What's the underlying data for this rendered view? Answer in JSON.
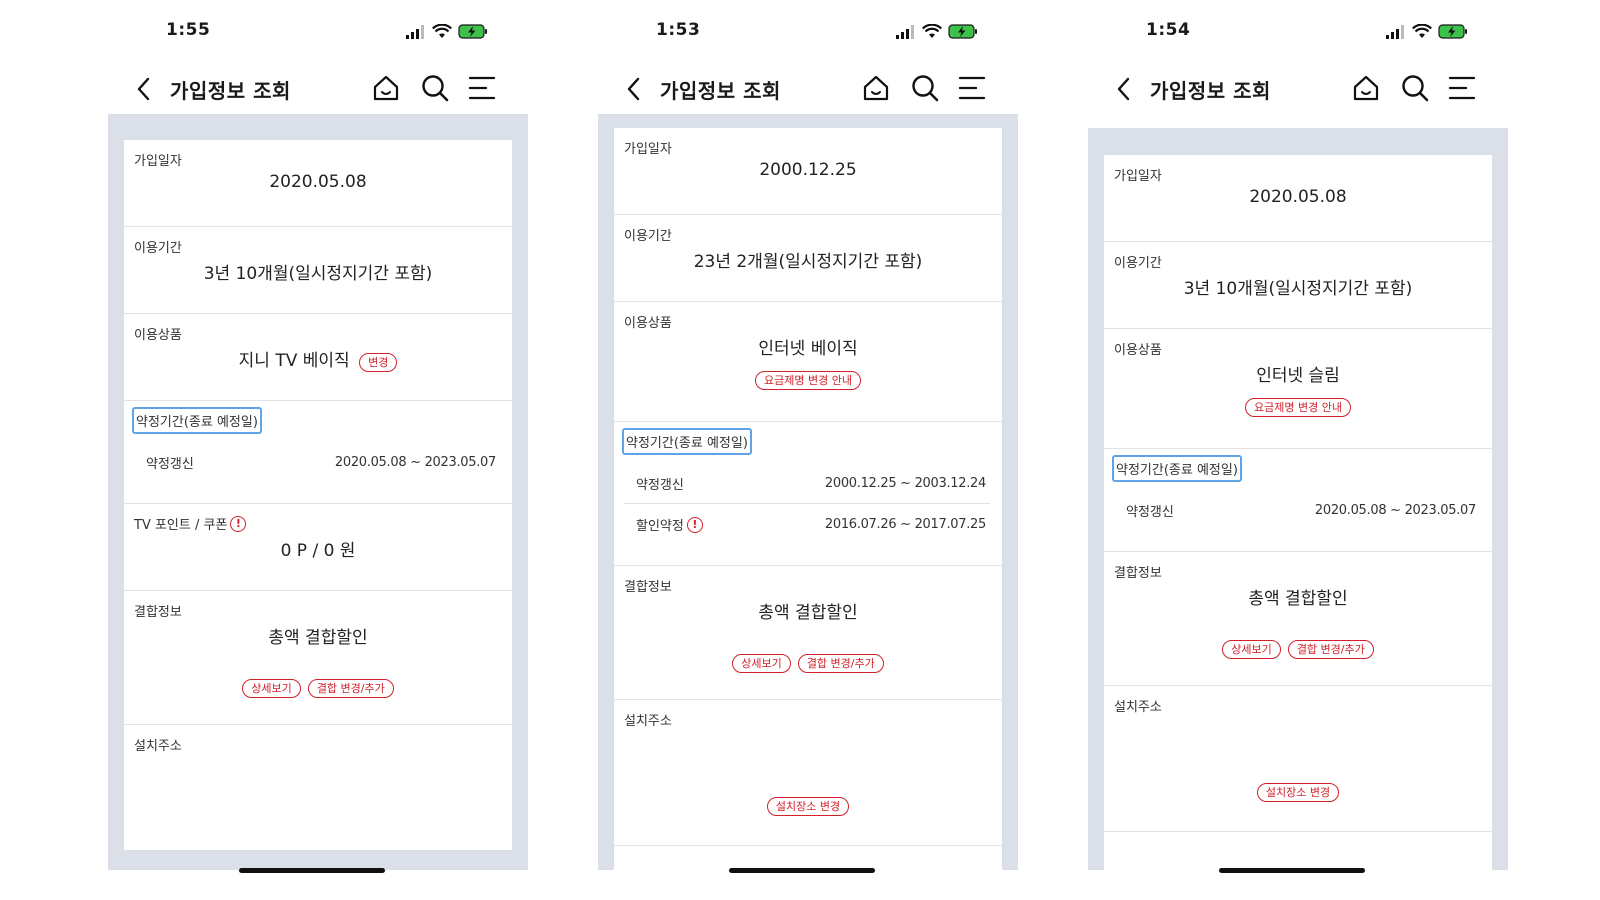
{
  "screens": [
    {
      "time": "1:55",
      "title": "가입정보 조회",
      "join_date": {
        "label": "가입일자",
        "value": "2020.05.08"
      },
      "period": {
        "label": "이용기간",
        "value": "3년 10개월(일시정지기간 포함)"
      },
      "product": {
        "label": "이용상품",
        "value": "지니 TV 베이직",
        "button": "변경"
      },
      "contract": {
        "label": "약정기간(종료 예정일)",
        "rows": [
          {
            "label": "약정갱신",
            "value": "2020.05.08 ~ 2023.05.07"
          }
        ]
      },
      "points": {
        "label": "TV 포인트 / 쿠폰",
        "value": "0 P / 0 원"
      },
      "bundle": {
        "label": "결합정보",
        "value": "총액 결합할인",
        "buttons": [
          "상세보기",
          "결합 변경/추가"
        ]
      },
      "address": {
        "label": "설치주소"
      }
    },
    {
      "time": "1:53",
      "title": "가입정보 조회",
      "join_date": {
        "label": "가입일자",
        "value": "2000.12.25"
      },
      "period": {
        "label": "이용기간",
        "value": "23년 2개월(일시정지기간 포함)"
      },
      "product": {
        "label": "이용상품",
        "value": "인터넷 베이직",
        "button": "요금제명 변경 안내"
      },
      "contract": {
        "label": "약정기간(종료 예정일)",
        "rows": [
          {
            "label": "약정갱신",
            "value": "2000.12.25 ~ 2003.12.24"
          },
          {
            "label": "할인약정",
            "value": "2016.07.26 ~ 2017.07.25"
          }
        ]
      },
      "bundle": {
        "label": "결합정보",
        "value": "총액 결합할인",
        "buttons": [
          "상세보기",
          "결합 변경/추가"
        ]
      },
      "address": {
        "label": "설치주소",
        "button": "설치장소 변경"
      }
    },
    {
      "time": "1:54",
      "title": "가입정보 조회",
      "join_date": {
        "label": "가입일자",
        "value": "2020.05.08"
      },
      "period": {
        "label": "이용기간",
        "value": "3년 10개월(일시정지기간 포함)"
      },
      "product": {
        "label": "이용상품",
        "value": "인터넷 슬림",
        "button": "요금제명 변경 안내"
      },
      "contract": {
        "label": "약정기간(종료 예정일)",
        "rows": [
          {
            "label": "약정갱신",
            "value": "2020.05.08 ~ 2023.05.07"
          }
        ]
      },
      "bundle": {
        "label": "결합정보",
        "value": "총액 결합할인",
        "buttons": [
          "상세보기",
          "결합 변경/추가"
        ]
      },
      "address": {
        "label": "설치주소",
        "button": "설치장소 변경"
      }
    }
  ],
  "icons": [
    "signal-icon",
    "wifi-icon",
    "battery-charging-icon",
    "back-icon",
    "home-icon",
    "search-icon",
    "menu-icon",
    "info-icon"
  ],
  "colors": {
    "accent": "#d3202a",
    "highlight": "#5fa4e6",
    "background": "#dbe0e8",
    "battery": "#3cc24a"
  }
}
